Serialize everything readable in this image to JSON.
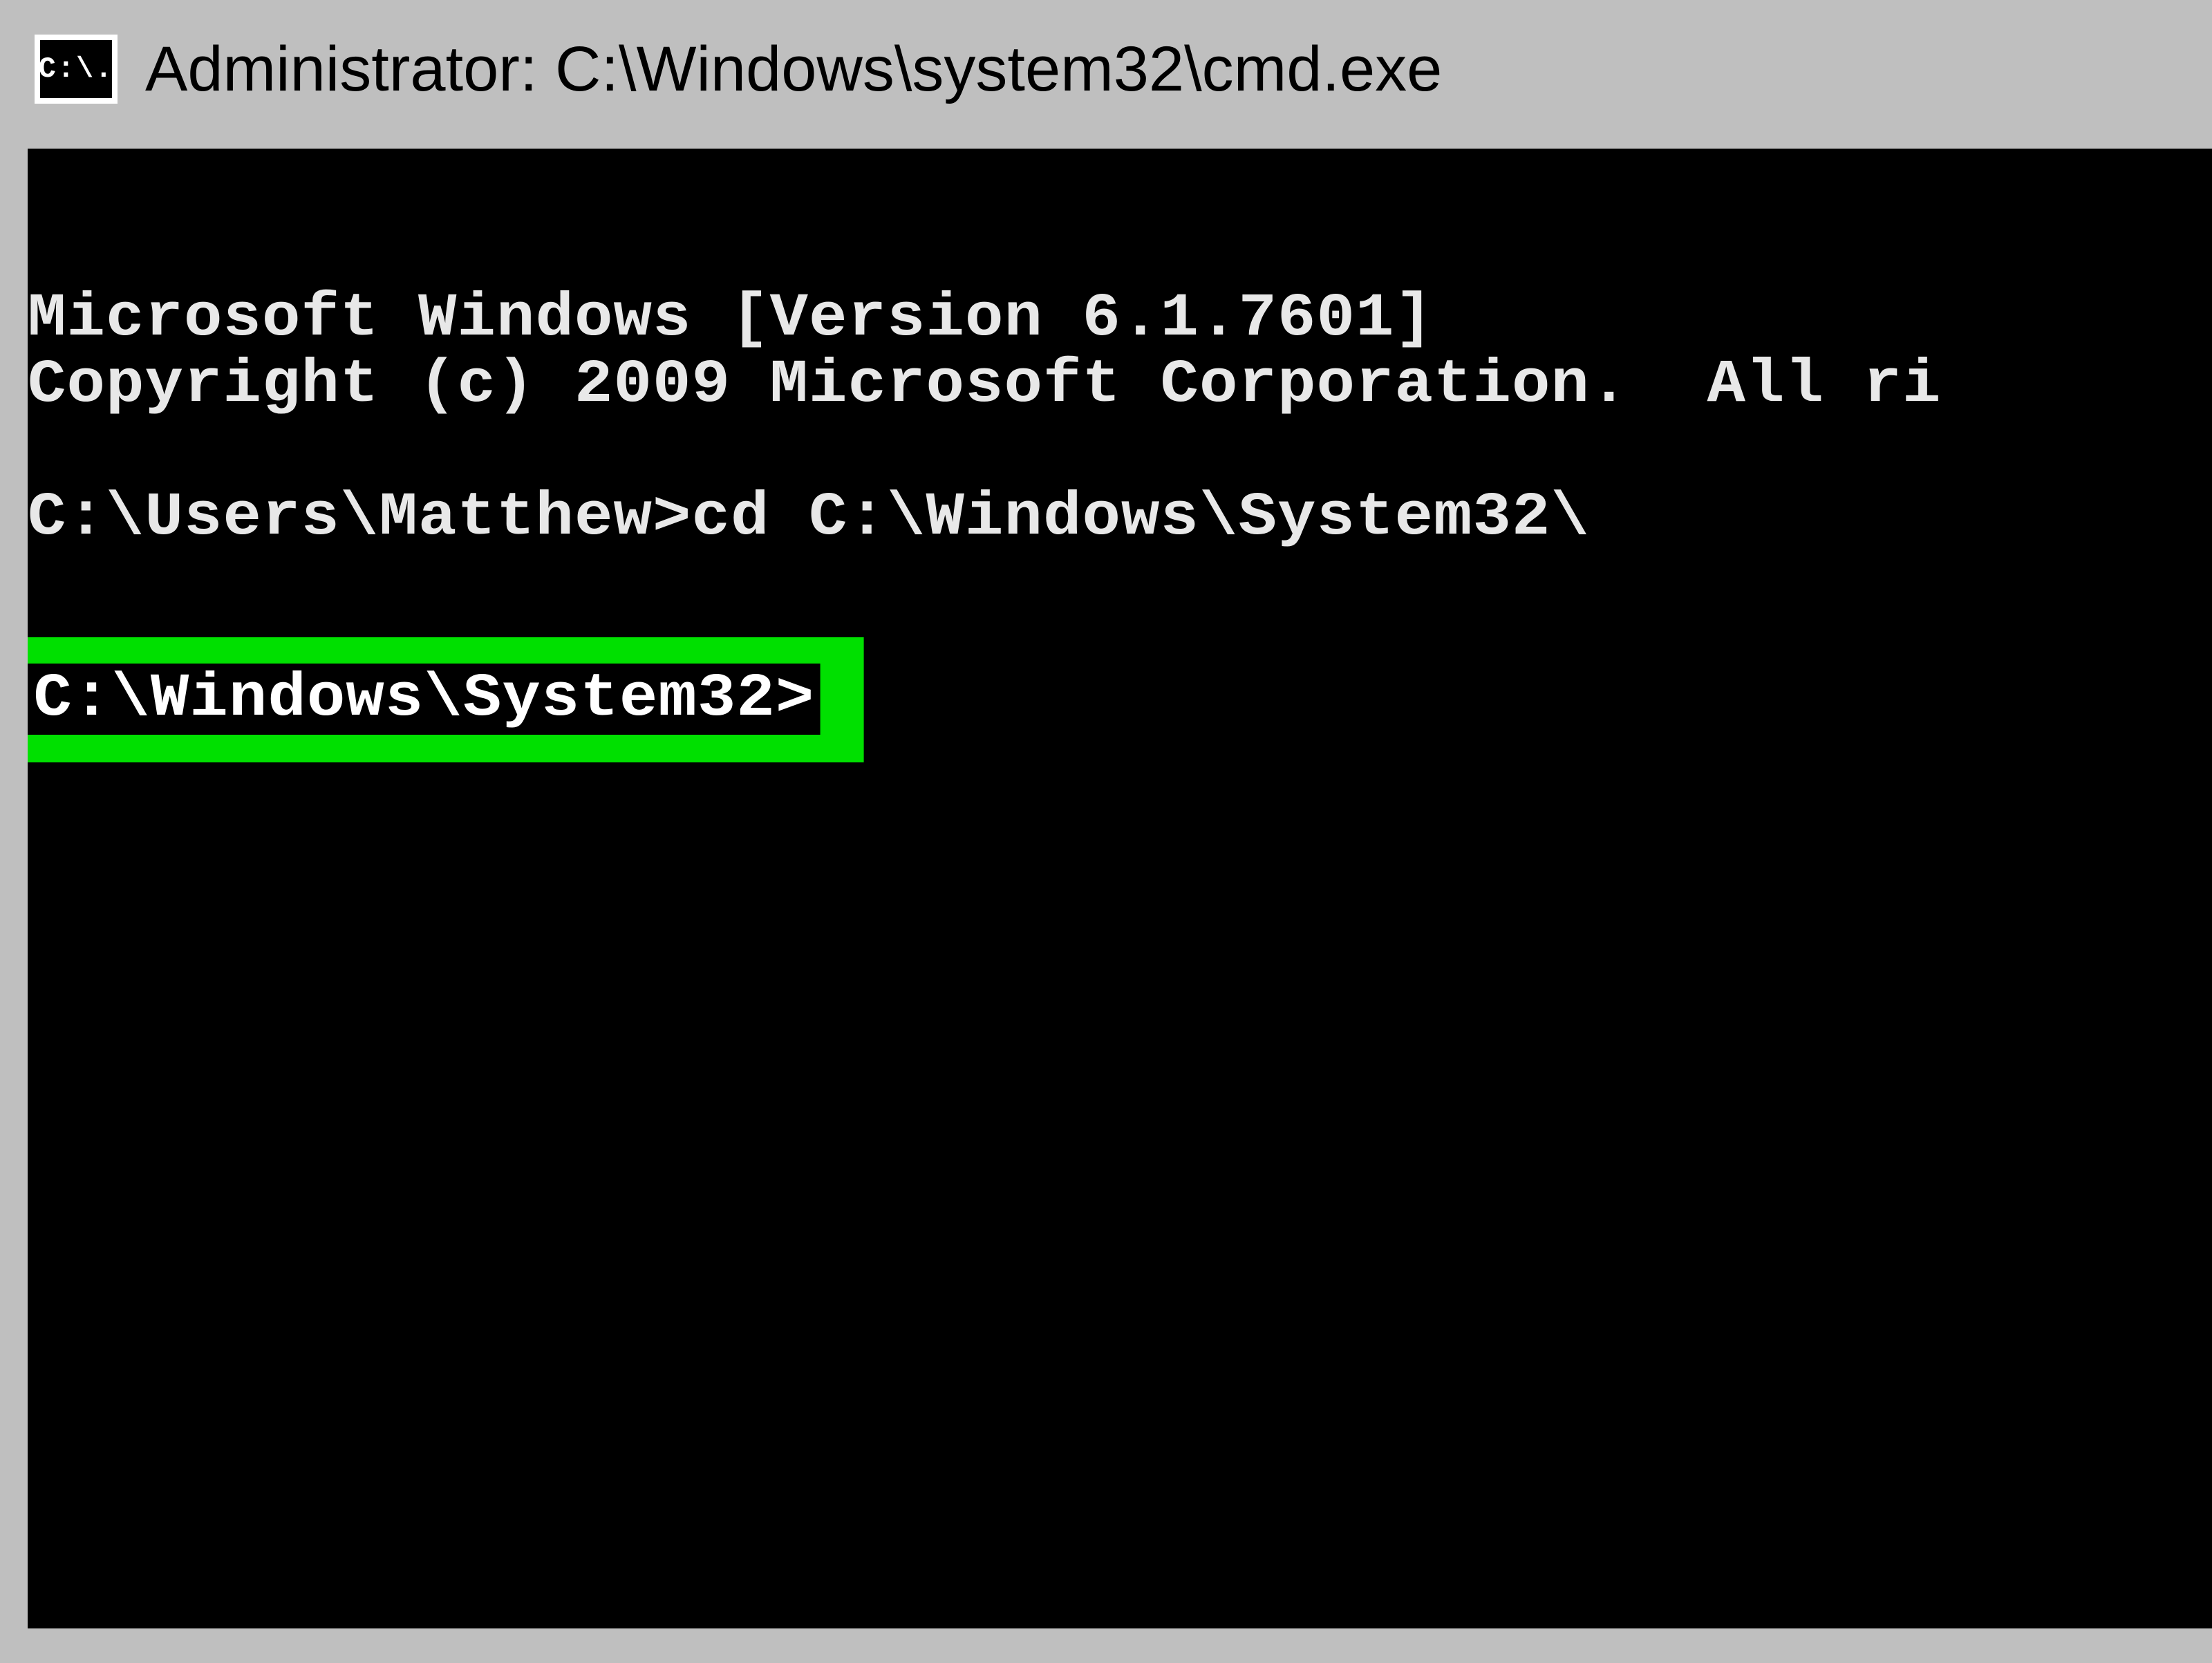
{
  "titlebar": {
    "icon_label": "C:\\.",
    "title": "Administrator: C:\\Windows\\system32\\cmd.exe"
  },
  "console": {
    "line1": "Microsoft Windows [Version 6.1.7601]",
    "line2": "Copyright (c) 2009 Microsoft Corporation.  All ri",
    "line3": "C:\\Users\\Matthew>cd C:\\Windows\\System32\\",
    "prompt_highlighted": "C:\\Windows\\System32>"
  }
}
